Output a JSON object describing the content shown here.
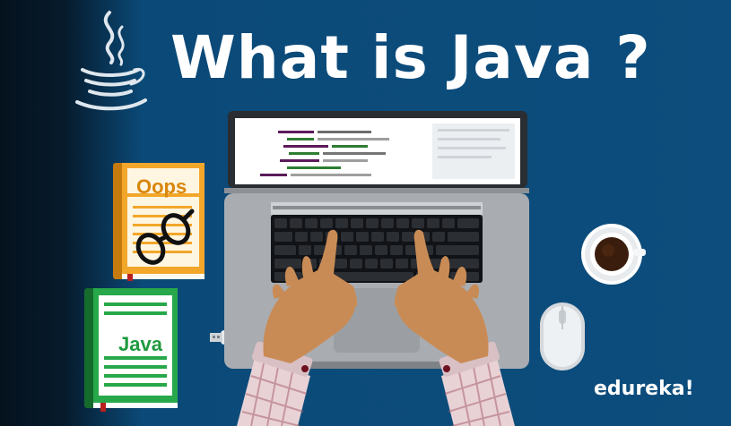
{
  "title": "What is Java ?",
  "books": {
    "oops_label": "Oops",
    "java_label": "Java"
  },
  "brand": "edureka!",
  "icons": [
    "java-logo-icon",
    "laptop-icon",
    "book-icon",
    "glasses-icon",
    "coffee-cup-icon",
    "mouse-icon",
    "usb-drive-icon",
    "hands-icon"
  ],
  "colors": {
    "background": "#0c4d7d",
    "title_text": "#ffffff",
    "oops_book": "#e59a1c",
    "java_book": "#1f9a3e",
    "laptop": "#a8acb0",
    "skin": "#c98b55"
  }
}
